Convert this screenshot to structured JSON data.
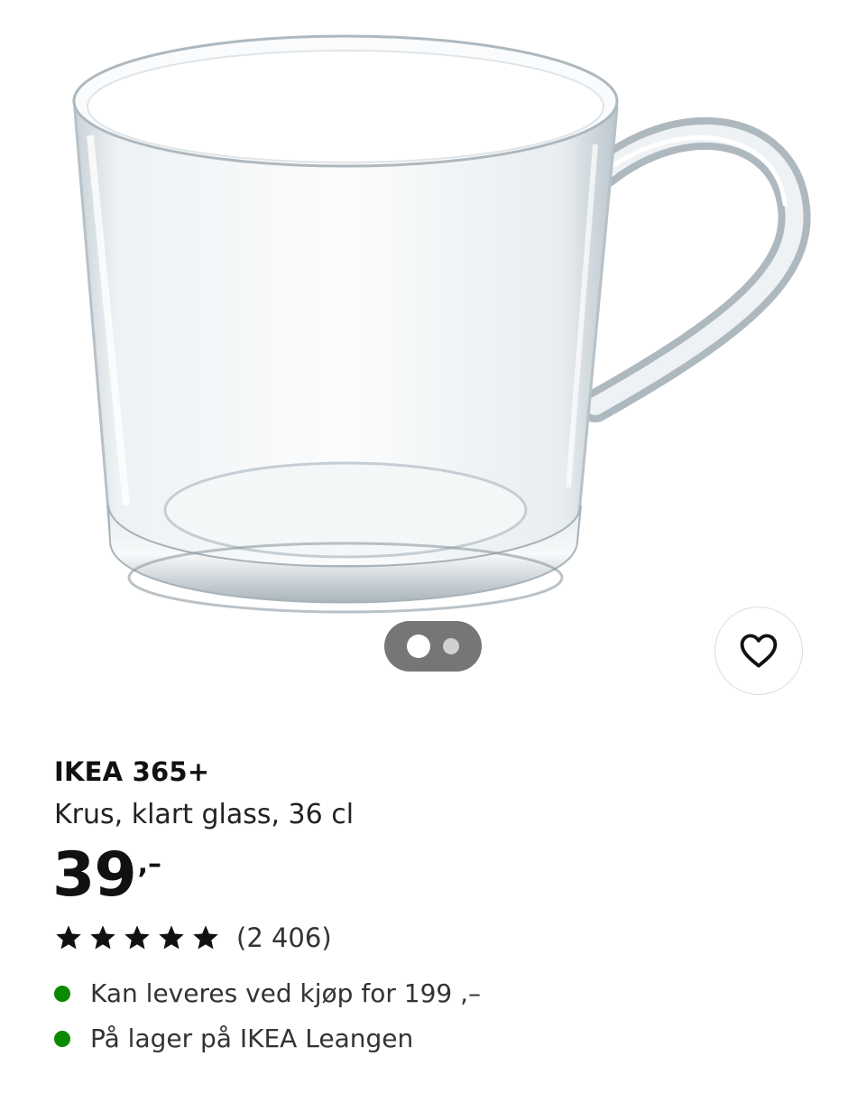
{
  "product": {
    "brand": "IKEA 365+",
    "description": "Krus, klart glass, 36 cl",
    "price_integer": "39",
    "price_suffix": ",–",
    "rating": {
      "stars": 5,
      "max_stars": 5,
      "review_count": "(2 406)"
    },
    "availability": [
      {
        "text": "Kan leveres ved kjøp for 199 ,–",
        "status_color": "#0a8a00"
      },
      {
        "text": "På lager på IKEA Leangen",
        "status_color": "#0a8a00"
      }
    ]
  },
  "carousel": {
    "total": 2,
    "active_index": 0
  },
  "icons": {
    "favorite": "heart-outline-icon",
    "rating": "star-icon",
    "status": "green-dot-icon"
  },
  "colors": {
    "background": "#ffffff",
    "text": "#111111",
    "carousel_pill": "#767676",
    "in_stock": "#0a8a00"
  }
}
